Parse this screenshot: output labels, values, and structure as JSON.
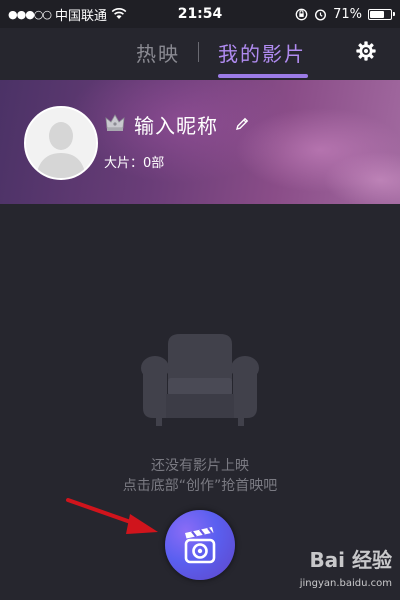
{
  "status_bar": {
    "carrier": "中国联通",
    "time": "21:54",
    "battery": "71%",
    "battery_level": 0.71
  },
  "tabs": {
    "hot": "热映",
    "mine": "我的影片",
    "active": "mine"
  },
  "profile": {
    "nickname": "输入昵称",
    "films_label": "大片：0部"
  },
  "empty_state": {
    "line1": "还没有影片上映",
    "line2": "点击底部“创作”抢首映吧"
  },
  "icons": {
    "settings": "gear-icon",
    "crown": "crown-icon",
    "edit": "pencil-icon",
    "sofa": "sofa-icon",
    "create": "clapperboard-camera-icon"
  },
  "watermark": {
    "logo": "Bai 经验",
    "url": "jingyan.baidu.com"
  },
  "colors": {
    "background": "#26262e",
    "accent": "#9b7be6",
    "annotation_arrow": "#d0141c"
  }
}
